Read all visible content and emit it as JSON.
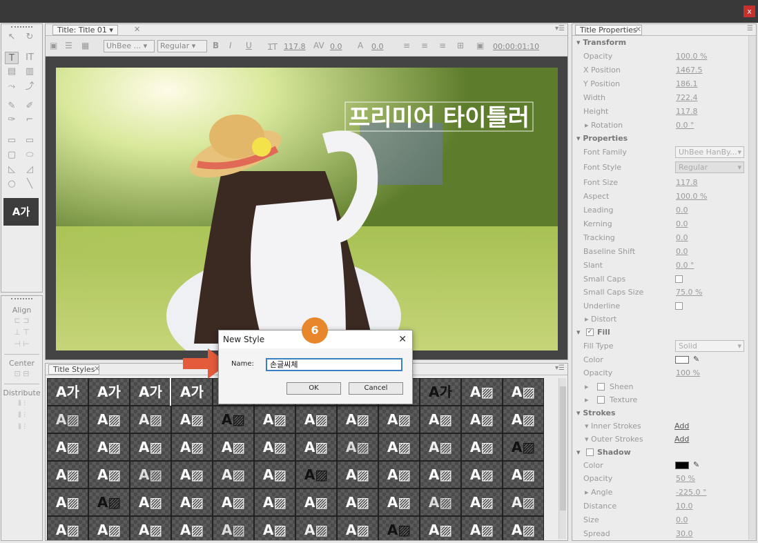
{
  "window": {
    "close_label": "x"
  },
  "main": {
    "tab_label": "Title: Title 01",
    "toolbar": {
      "font_family": "UhBee ...",
      "font_style": "Regular",
      "font_size": "117.8",
      "kerning": "0.0",
      "leading": "0.0",
      "timecode": "00:00:01:10"
    },
    "canvas_title": "프리미어 타이틀러"
  },
  "tools": {
    "preview_text": "A가",
    "align_header": "Align",
    "center_header": "Center",
    "distribute_header": "Distribute"
  },
  "styles": {
    "tab_label": "Title Styles",
    "swatch_rows": [
      [
        "A가",
        "A가",
        "A가",
        "A가",
        "A가",
        "A가",
        "A가",
        "A가",
        "A가",
        "A가",
        "A▨",
        "A▨"
      ],
      [
        "A▨",
        "A▨",
        "A▨",
        "A▨",
        "A▨",
        "A▨",
        "A▨",
        "A▨",
        "A▨",
        "A▨",
        "A▨",
        "A▨"
      ],
      [
        "A▨",
        "A▨",
        "A▨",
        "A▨",
        "A▨",
        "A▨",
        "A▨",
        "A▨",
        "A▨",
        "A▨",
        "A▨",
        "A▨"
      ],
      [
        "A▨",
        "A▨",
        "A▨",
        "A▨",
        "A▨",
        "A▨",
        "A▨",
        "A▨",
        "A▨",
        "A▨",
        "A▨",
        "A▨"
      ],
      [
        "A▨",
        "A▨",
        "A▨",
        "A▨",
        "A▨",
        "A▨",
        "A▨",
        "A▨",
        "A▨",
        "A▨",
        "A▨",
        "A▨"
      ],
      [
        "A▨",
        "A▨",
        "A▨",
        "A▨",
        "A▨",
        "A▨",
        "A▨",
        "A▨",
        "A▨",
        "A▨",
        "A▨",
        "A▨"
      ]
    ]
  },
  "dialog": {
    "title": "New Style",
    "name_label": "Name:",
    "name_value": "손글씨체",
    "ok_label": "OK",
    "cancel_label": "Cancel",
    "step_badge": "6"
  },
  "properties": {
    "tab_label": "Title Properties",
    "transform_header": "Transform",
    "opacity_label": "Opacity",
    "opacity_value": "100.0 %",
    "xpos_label": "X Position",
    "xpos_value": "1467.5",
    "ypos_label": "Y Position",
    "ypos_value": "186.1",
    "width_label": "Width",
    "width_value": "722.4",
    "height_label": "Height",
    "height_value": "117.8",
    "rotation_label": "Rotation",
    "rotation_value": "0.0 °",
    "properties_header": "Properties",
    "font_family_label": "Font Family",
    "font_family_value": "UhBee HanBy...",
    "font_style_label": "Font Style",
    "font_style_value": "Regular",
    "font_size_label": "Font Size",
    "font_size_value": "117.8",
    "aspect_label": "Aspect",
    "aspect_value": "100.0 %",
    "leading_label": "Leading",
    "leading_value": "0.0",
    "kerning_label": "Kerning",
    "kerning_value": "0.0",
    "tracking_label": "Tracking",
    "tracking_value": "0.0",
    "baseline_label": "Baseline Shift",
    "baseline_value": "0.0",
    "slant_label": "Slant",
    "slant_value": "0.0 °",
    "smallcaps_label": "Small Caps",
    "smallcaps_size_label": "Small Caps Size",
    "smallcaps_size_value": "75.0 %",
    "underline_label": "Underline",
    "distort_label": "Distort",
    "fill_header": "Fill",
    "fill_type_label": "Fill Type",
    "fill_type_value": "Solid",
    "color_label": "Color",
    "fill_opacity_label": "Opacity",
    "fill_opacity_value": "100 %",
    "sheen_label": "Sheen",
    "texture_label": "Texture",
    "strokes_header": "Strokes",
    "inner_strokes_label": "Inner Strokes",
    "inner_add": "Add",
    "outer_strokes_label": "Outer Strokes",
    "outer_add": "Add",
    "shadow_header": "Shadow",
    "shadow_color_label": "Color",
    "shadow_opacity_label": "Opacity",
    "shadow_opacity_value": "50 %",
    "angle_label": "Angle",
    "angle_value": "-225.0 °",
    "distance_label": "Distance",
    "distance_value": "10.0",
    "size_label": "Size",
    "size_value": "0.0",
    "spread_label": "Spread",
    "spread_value": "30.0"
  },
  "colors": {
    "accent": "#e8862c",
    "dialog_focus": "#3a7fc4",
    "close": "#c8302c"
  }
}
